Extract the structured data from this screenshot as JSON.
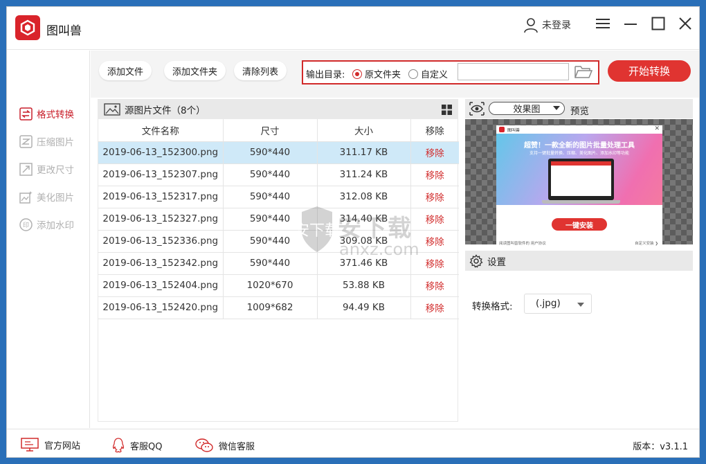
{
  "app": {
    "title": "图叫兽",
    "login_label": "未登录"
  },
  "sidebar": {
    "items": [
      {
        "label": "格式转换",
        "active": true,
        "icon": "swap-icon"
      },
      {
        "label": "压缩图片",
        "active": false,
        "icon": "compress-icon"
      },
      {
        "label": "更改尺寸",
        "active": false,
        "icon": "resize-icon"
      },
      {
        "label": "美化图片",
        "active": false,
        "icon": "beautify-icon"
      },
      {
        "label": "添加水印",
        "active": false,
        "icon": "watermark-icon"
      }
    ]
  },
  "toolbar": {
    "add_file": "添加文件",
    "add_folder": "添加文件夹",
    "clear_list": "清除列表",
    "output_label": "输出目录:",
    "radio_original": "原文件夹",
    "radio_custom": "自定义",
    "output_path": "",
    "start_button": "开始转换"
  },
  "file_list": {
    "header": "源图片文件（8个）",
    "columns": [
      "文件名称",
      "尺寸",
      "大小",
      "移除"
    ],
    "rows": [
      {
        "name": "2019-06-13_152300.png",
        "size": "590*440",
        "filesize": "311.17 KB",
        "remove": "移除",
        "selected": true
      },
      {
        "name": "2019-06-13_152307.png",
        "size": "590*440",
        "filesize": "311.24 KB",
        "remove": "移除"
      },
      {
        "name": "2019-06-13_152317.png",
        "size": "590*440",
        "filesize": "312.08 KB",
        "remove": "移除"
      },
      {
        "name": "2019-06-13_152327.png",
        "size": "590*440",
        "filesize": "314.40 KB",
        "remove": "移除"
      },
      {
        "name": "2019-06-13_152336.png",
        "size": "590*440",
        "filesize": "309.08 KB",
        "remove": "移除"
      },
      {
        "name": "2019-06-13_152342.png",
        "size": "590*440",
        "filesize": "371.46 KB",
        "remove": "移除"
      },
      {
        "name": "2019-06-13_152404.png",
        "size": "1020*670",
        "filesize": "53.88 KB",
        "remove": "移除"
      },
      {
        "name": "2019-06-13_152420.png",
        "size": "1009*682",
        "filesize": "94.49 KB",
        "remove": "移除"
      }
    ]
  },
  "preview": {
    "mode_select": "效果图",
    "label": "预览",
    "image": {
      "title": "超赞！一款全新的图片批量处理工具",
      "subtitle": "支持一键批量转换、压缩、美化图片、添加水印等功能",
      "install_button": "一键安装",
      "agree_text": "阅读图叫兽软件的 用户协议",
      "custom_install": "自定义安装 ❯"
    }
  },
  "settings": {
    "header": "设置",
    "format_label": "转换格式:",
    "format_value": "(.jpg)"
  },
  "watermark": {
    "text_cn": "安下载",
    "text_en": "anxz.com"
  },
  "footer": {
    "website": "官方网站",
    "qq": "客服QQ",
    "wechat": "微信客服",
    "version": "版本：v3.1.1"
  },
  "colors": {
    "accent_red": "#d12a2a",
    "start_button": "#e03431",
    "selected_row": "#cfe9f8",
    "desktop_blue": "#2a6fb8"
  }
}
